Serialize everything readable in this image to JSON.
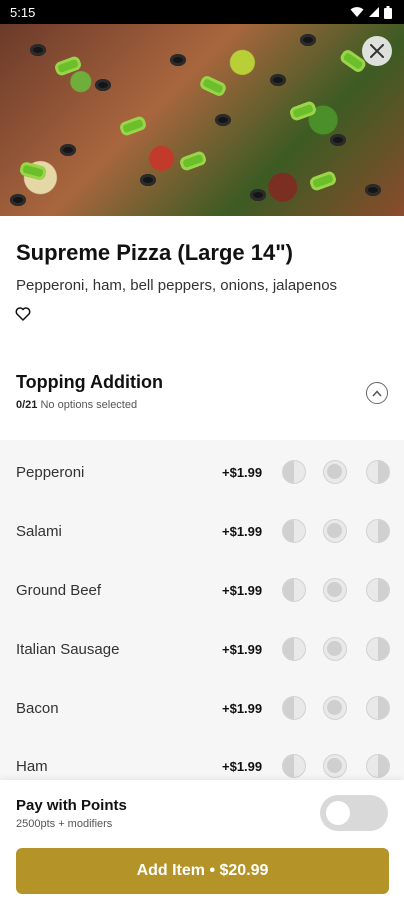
{
  "status_bar": {
    "time": "5:15"
  },
  "item": {
    "title": "Supreme Pizza (Large 14\")",
    "description": "Pepperoni, ham, bell peppers, onions, jalapenos"
  },
  "section": {
    "title": "Topping Addition",
    "count": "0/21",
    "status": "No options selected"
  },
  "options": [
    {
      "label": "Pepperoni",
      "price": "+$1.99"
    },
    {
      "label": "Salami",
      "price": "+$1.99"
    },
    {
      "label": "Ground Beef",
      "price": "+$1.99"
    },
    {
      "label": "Italian Sausage",
      "price": "+$1.99"
    },
    {
      "label": "Bacon",
      "price": "+$1.99"
    },
    {
      "label": "Ham",
      "price": "+$1.99"
    }
  ],
  "points": {
    "title": "Pay with Points",
    "subtitle": "2500pts + modifiers",
    "enabled": false
  },
  "add_button": {
    "label": "Add Item • $20.99"
  },
  "colors": {
    "accent": "#b49428",
    "options_bg": "#f6f6f6",
    "toggle_off": "#d9d9d9"
  }
}
